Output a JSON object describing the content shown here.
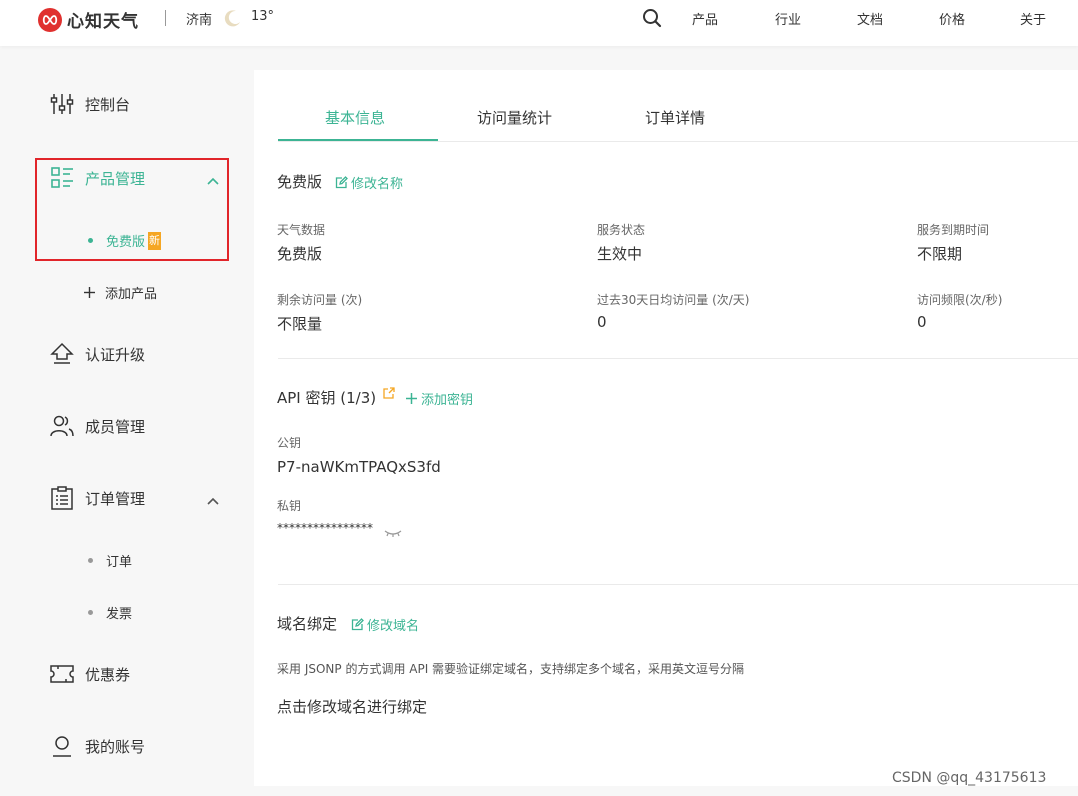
{
  "header": {
    "brand": "心知天气",
    "city": "济南",
    "temperature": "13°",
    "nav": [
      "产品",
      "行业",
      "文档",
      "价格",
      "关于"
    ]
  },
  "sidebar": {
    "console": "控制台",
    "product_mgmt": "产品管理",
    "free_edition": "免费版",
    "new_badge": "新",
    "add_product": "添加产品",
    "cert_upgrade": "认证升级",
    "member_mgmt": "成员管理",
    "order_mgmt": "订单管理",
    "orders": "订单",
    "invoice": "发票",
    "coupons": "优惠券",
    "my_account": "我的账号"
  },
  "tabs": [
    "基本信息",
    "访问量统计",
    "订单详情"
  ],
  "product": {
    "name": "免费版",
    "rename_link": "修改名称",
    "fields": [
      {
        "label": "天气数据",
        "value": "免费版"
      },
      {
        "label": "服务状态",
        "value": "生效中"
      },
      {
        "label": "服务到期时间",
        "value": "不限期"
      },
      {
        "label": "剩余访问量 (次)",
        "value": "不限量"
      },
      {
        "label": "过去30天日均访问量 (次/天)",
        "value": "0"
      },
      {
        "label": "访问频限(次/秒)",
        "value": "0"
      }
    ]
  },
  "api": {
    "title": "API 密钥 (1/3)",
    "add_link": "添加密钥",
    "public_key_label": "公钥",
    "public_key": "P7-naWKmTPAQxS3fd",
    "private_key_label": "私钥",
    "private_key": "****************"
  },
  "domain": {
    "title": "域名绑定",
    "edit_link": "修改域名",
    "description": "采用 JSONP 的方式调用 API 需要验证绑定域名，支持绑定多个域名，采用英文逗号分隔",
    "prompt": "点击修改域名进行绑定"
  },
  "watermark": "CSDN @qq_43175613",
  "colors": {
    "accent": "#3cb494",
    "brand": "#e0312f",
    "badge": "#f5a623",
    "highlight": "#e1252a"
  }
}
